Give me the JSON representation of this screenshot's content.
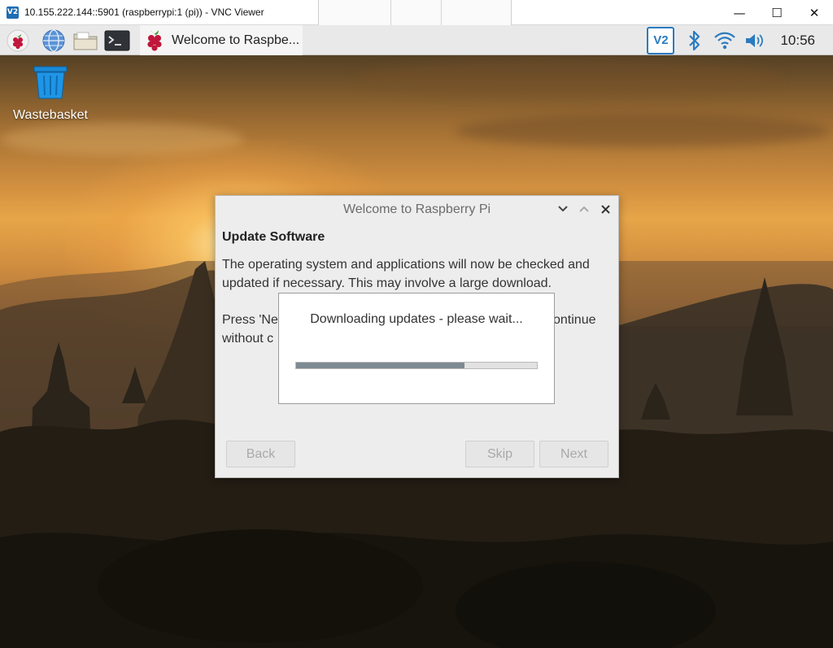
{
  "vnc_window": {
    "app_icon": "V2",
    "title": "10.155.222.144::5901 (raspberrypi:1 (pi)) - VNC Viewer",
    "controls": {
      "minimize": "—",
      "maximize": "☐",
      "close": "✕"
    }
  },
  "taskbar": {
    "launchers": [
      "raspberry-menu-icon",
      "web-browser-icon",
      "file-manager-icon",
      "terminal-icon"
    ],
    "active_task_label": "Welcome to Raspbe...",
    "tray": {
      "vnc_label": "V2",
      "icons": [
        "bluetooth-icon",
        "wifi-icon",
        "volume-icon"
      ],
      "clock": "10:56"
    }
  },
  "desktop": {
    "icons": [
      {
        "label": "Wastebasket",
        "icon": "wastebasket-icon"
      }
    ]
  },
  "dialog": {
    "title": "Welcome to Raspberry Pi",
    "heading": "Update Software",
    "paragraph1_line1": "The operating system and applications will now be checked and",
    "paragraph1_line2": "updated if necessary. This may involve a large download.",
    "paragraph2_line1": "Press 'Ne",
    "paragraph2_line1_tail": "ontinue",
    "paragraph2_line2": "without c",
    "buttons": {
      "back": "Back",
      "skip": "Skip",
      "next": "Next"
    }
  },
  "progress": {
    "message": "Downloading updates - please wait...",
    "fraction": 0.7
  },
  "colors": {
    "tray_accent": "#2a7bc0",
    "dialog_bg": "#ededed",
    "progress_fill": "#7e8a92"
  }
}
